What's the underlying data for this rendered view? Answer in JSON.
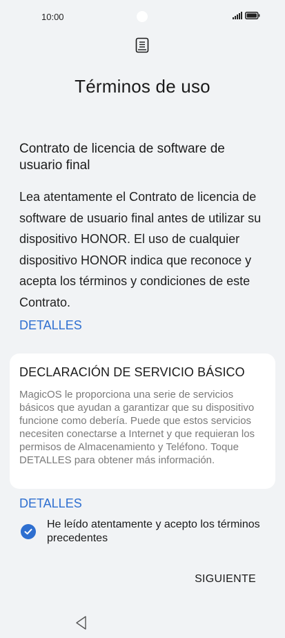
{
  "status_bar": {
    "time": "10:00"
  },
  "page": {
    "title": "Términos de uso"
  },
  "eula": {
    "heading": "Contrato de licencia de software de usuario final",
    "body": "Lea atentamente el Contrato de licencia de software de usuario final antes de utilizar su dispositivo HONOR. El uso de cualquier dispositivo HONOR indica que reconoce y acepta los términos y condiciones de este Contrato.",
    "details_link": "DETALLES"
  },
  "service_card": {
    "title": "DECLARACIÓN DE SERVICIO BÁSICO",
    "body": "MagicOS le proporciona una serie de servicios básicos que ayudan a garantizar que su dispositivo funcione como debería. Puede que estos servicios necesiten conectarse a Internet y que requieran los permisos de Almacenamiento y Teléfono. Toque DETALLES para obtener más información.",
    "details_link": "DETALLES"
  },
  "agreement": {
    "checked": true,
    "label": "He leído atentamente y acepto los términos precedentes"
  },
  "actions": {
    "next_label": "SIGUIENTE"
  },
  "icons": {
    "document": "document-icon",
    "signal": "signal-icon",
    "battery": "battery-icon",
    "check": "check-icon",
    "back": "back-triangle-icon"
  },
  "colors": {
    "background": "#f1f3f5",
    "accent": "#2e6fd0",
    "card": "#ffffff",
    "muted_text": "#7a7a7a"
  }
}
